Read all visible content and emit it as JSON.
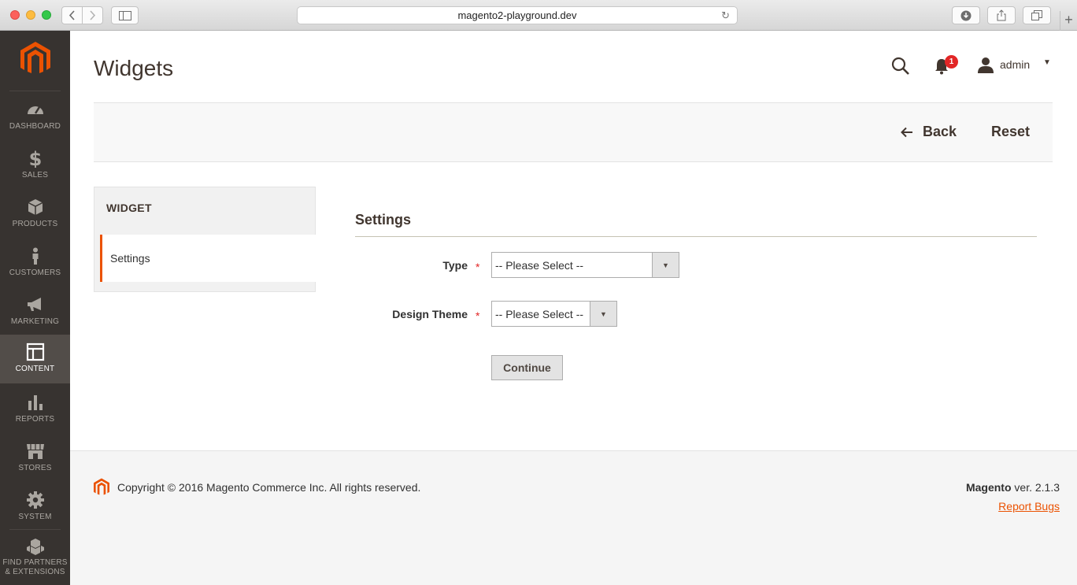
{
  "browser": {
    "url": "magento2-playground.dev"
  },
  "menu": {
    "items": [
      {
        "label": "DASHBOARD"
      },
      {
        "label": "SALES"
      },
      {
        "label": "PRODUCTS"
      },
      {
        "label": "CUSTOMERS"
      },
      {
        "label": "MARKETING"
      },
      {
        "label": "CONTENT"
      },
      {
        "label": "REPORTS"
      },
      {
        "label": "STORES"
      },
      {
        "label": "SYSTEM"
      },
      {
        "label": "FIND PARTNERS\n& EXTENSIONS"
      }
    ],
    "active": "CONTENT"
  },
  "header": {
    "title": "Widgets",
    "notifications_count": "1",
    "user": "admin"
  },
  "actions": {
    "back": "Back",
    "reset": "Reset"
  },
  "tabs": {
    "title": "WIDGET",
    "items": [
      {
        "label": "Settings"
      }
    ]
  },
  "form": {
    "section_title": "Settings",
    "fields": [
      {
        "label": "Type",
        "value": "-- Please Select --"
      },
      {
        "label": "Design Theme",
        "value": "-- Please Select --"
      }
    ],
    "required_mark": "*",
    "continue": "Continue"
  },
  "footer": {
    "copyright": "Copyright © 2016 Magento Commerce Inc. All rights reserved.",
    "brand": "Magento",
    "version": "ver. 2.1.3",
    "report_bugs": "Report Bugs"
  },
  "colors": {
    "accent": "#eb5202",
    "sidebar": "#373330",
    "badge": "#e22626"
  }
}
